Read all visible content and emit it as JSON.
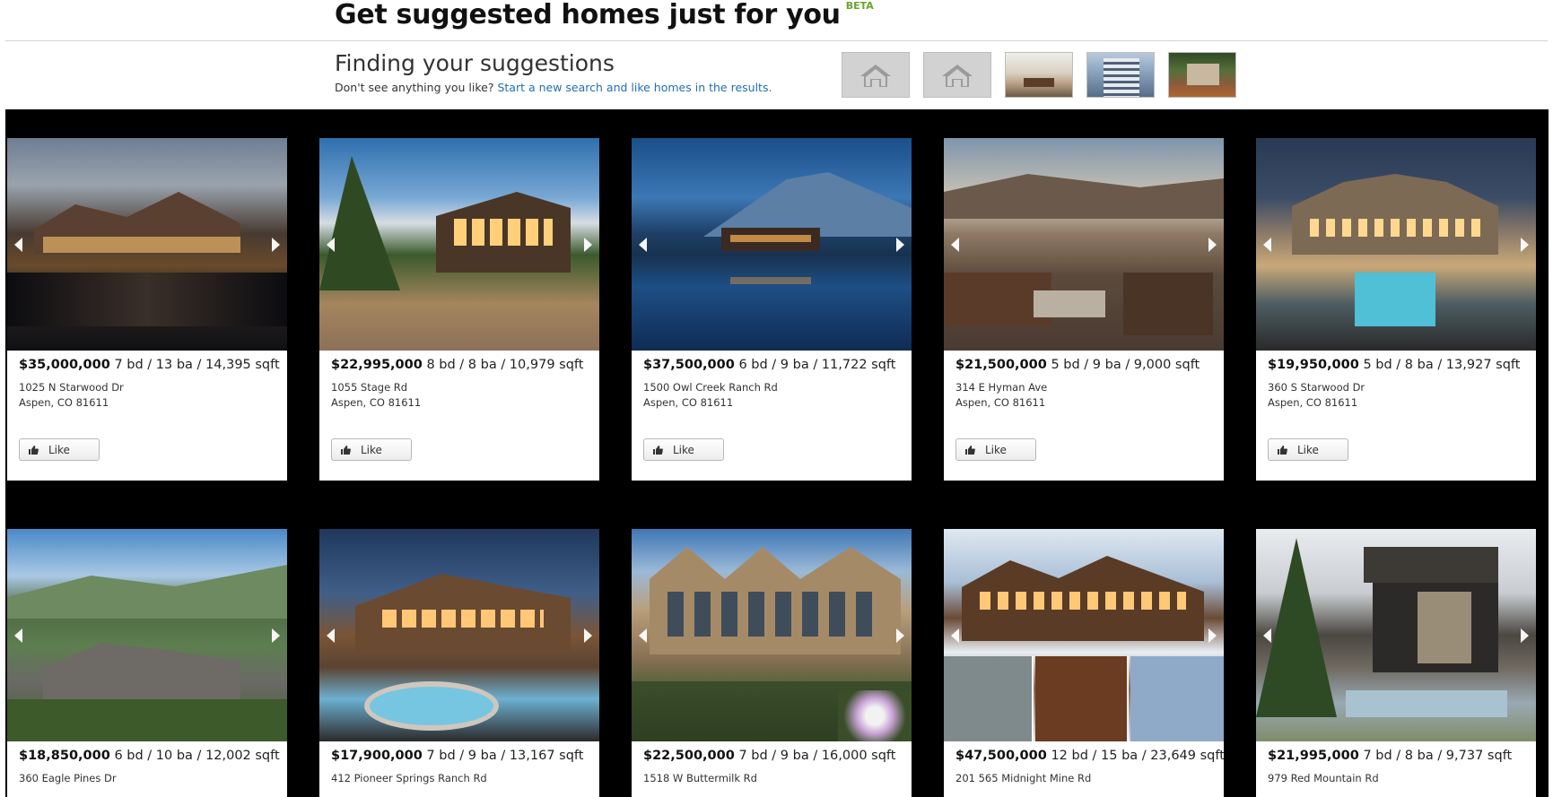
{
  "header": {
    "title": "Get suggested homes just for you",
    "badge": "BETA",
    "subtitle": "Finding your suggestions",
    "prompt_text": "Don't see anything you like?",
    "prompt_link": "Start a new search and like homes in the results."
  },
  "liked_thumbs": [
    {
      "kind": "placeholder",
      "icon": "house-icon"
    },
    {
      "kind": "placeholder",
      "icon": "house-icon"
    },
    {
      "kind": "photo"
    },
    {
      "kind": "photo"
    },
    {
      "kind": "photo"
    }
  ],
  "like_label": "Like",
  "listings": [
    {
      "price": "$35,000,000",
      "details": "7 bd / 13 ba / 14,395 sqft",
      "street": "1025 N Starwood Dr",
      "city": "Aspen, CO 81611"
    },
    {
      "price": "$22,995,000",
      "details": "8 bd / 8 ba / 10,979 sqft",
      "street": "1055 Stage Rd",
      "city": "Aspen, CO 81611"
    },
    {
      "price": "$37,500,000",
      "details": "6 bd / 9 ba / 11,722 sqft",
      "street": "1500 Owl Creek Ranch Rd",
      "city": "Aspen, CO 81611"
    },
    {
      "price": "$21,500,000",
      "details": "5 bd / 9 ba / 9,000 sqft",
      "street": "314 E Hyman Ave",
      "city": "Aspen, CO 81611"
    },
    {
      "price": "$19,950,000",
      "details": "5 bd / 8 ba / 13,927 sqft",
      "street": "360 S Starwood Dr",
      "city": "Aspen, CO 81611"
    },
    {
      "price": "$18,850,000",
      "details": "6 bd / 10 ba / 12,002 sqft",
      "street": "360 Eagle Pines Dr",
      "city": ""
    },
    {
      "price": "$17,900,000",
      "details": "7 bd / 9 ba / 13,167 sqft",
      "street": "412 Pioneer Springs Ranch Rd",
      "city": ""
    },
    {
      "price": "$22,500,000",
      "details": "7 bd / 9 ba / 16,000 sqft",
      "street": "1518 W Buttermilk Rd",
      "city": ""
    },
    {
      "price": "$47,500,000",
      "details": "12 bd / 15 ba / 23,649 sqft",
      "street": "201 565 Midnight Mine Rd",
      "city": ""
    },
    {
      "price": "$21,995,000",
      "details": "7 bd / 8 ba / 9,737 sqft",
      "street": "979 Red Mountain Rd",
      "city": ""
    }
  ]
}
